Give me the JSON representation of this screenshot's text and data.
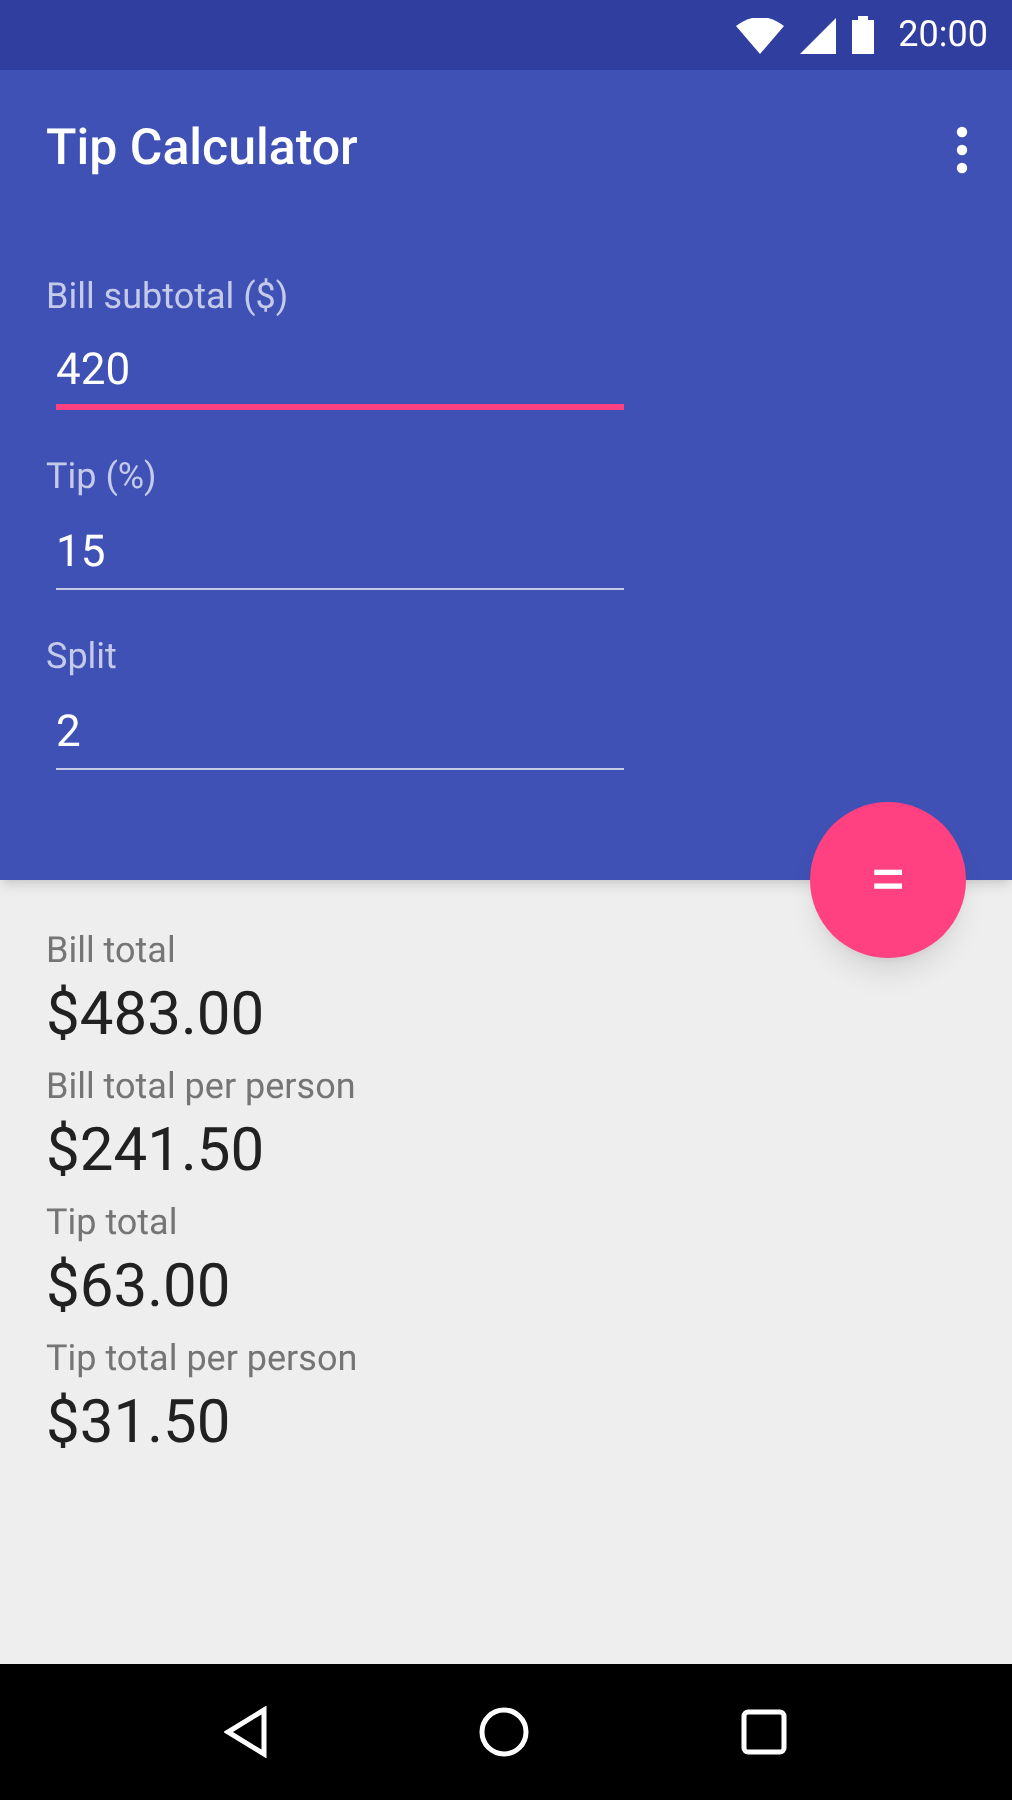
{
  "status_bar": {
    "time": "20:00"
  },
  "app_bar": {
    "title": "Tip Calculator"
  },
  "fields": [
    {
      "label": "Bill subtotal ($)",
      "value": "420",
      "focused": true
    },
    {
      "label": "Tip (%)",
      "value": "15",
      "focused": false
    },
    {
      "label": "Split",
      "value": "2",
      "focused": false
    }
  ],
  "fab": {
    "label": "="
  },
  "results": [
    {
      "label": "Bill total",
      "value": "$483.00"
    },
    {
      "label": "Bill total per person",
      "value": "$241.50"
    },
    {
      "label": "Tip total",
      "value": "$63.00"
    },
    {
      "label": "Tip total per person",
      "value": "$31.50"
    }
  ]
}
